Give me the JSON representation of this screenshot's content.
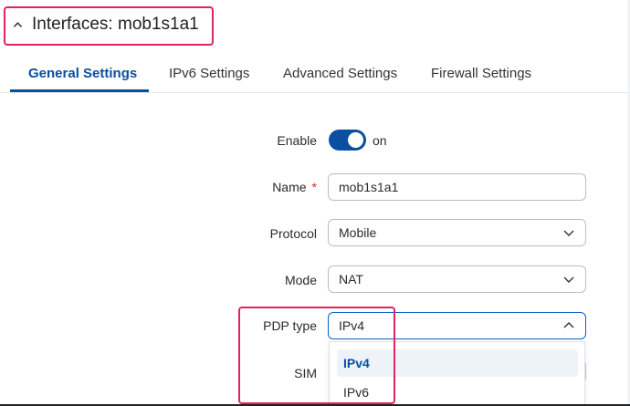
{
  "header": {
    "title": "Interfaces: mob1s1a1"
  },
  "tabs": [
    {
      "label": "General Settings",
      "active": true
    },
    {
      "label": "IPv6 Settings",
      "active": false
    },
    {
      "label": "Advanced Settings",
      "active": false
    },
    {
      "label": "Firewall Settings",
      "active": false
    }
  ],
  "form": {
    "enable": {
      "label": "Enable",
      "state_text": "on",
      "checked": true
    },
    "name": {
      "label": "Name",
      "required_marker": "*",
      "value": "mob1s1a1"
    },
    "protocol": {
      "label": "Protocol",
      "value": "Mobile"
    },
    "mode": {
      "label": "Mode",
      "value": "NAT"
    },
    "pdp_type": {
      "label": "PDP type",
      "value": "IPv4",
      "options": [
        "IPv4",
        "IPv6"
      ]
    },
    "sim": {
      "label": "SIM"
    }
  },
  "colors": {
    "accent": "#0b4fa0",
    "highlight": "#e0245e",
    "required": "#d62b2b"
  }
}
